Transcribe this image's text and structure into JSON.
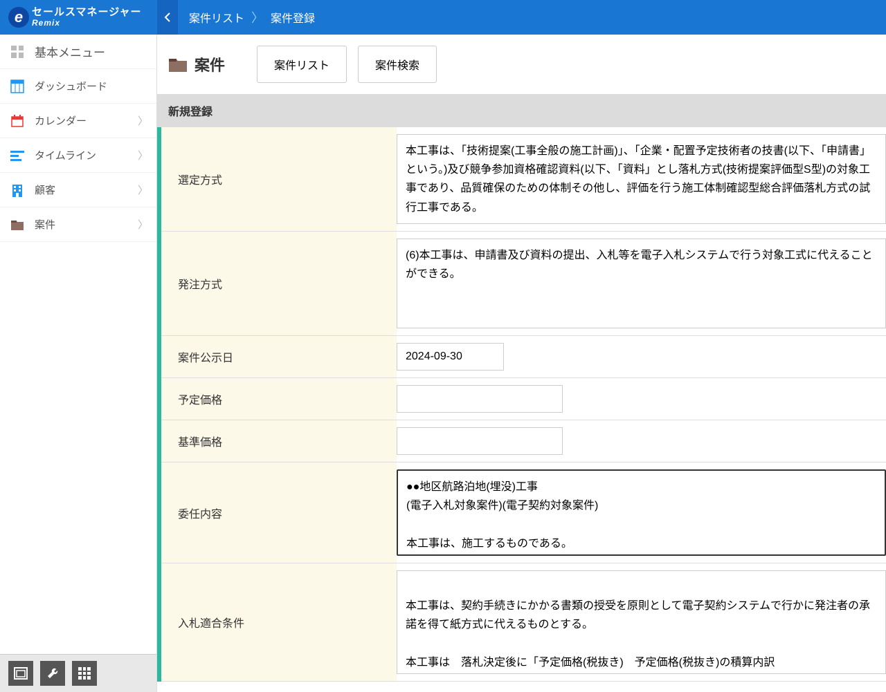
{
  "logo": {
    "main": "セールスマネージャー",
    "sub": "Remix"
  },
  "breadcrumb": {
    "item1": "案件リスト",
    "item2": "案件登録"
  },
  "sidebar": {
    "basic_menu": "基本メニュー",
    "dashboard": "ダッシュボード",
    "calendar": "カレンダー",
    "timeline": "タイムライン",
    "customer": "顧客",
    "case": "案件"
  },
  "content": {
    "title": "案件",
    "tab_list": "案件リスト",
    "tab_search": "案件検索",
    "section_new": "新規登録"
  },
  "form": {
    "selection_method": {
      "label": "選定方式",
      "value": "本工事は、「技術提案(工事全般の施工計画)」、「企業・配置予定技術者の技書(以下、「申請書」という。)及び競争参加資格確認資料(以下、「資料」とし落札方式(技術提案評価型S型)の対象工事であり、品質確保のための体制その他し、評価を行う施工体制確認型総合評価落札方式の試行工事である。"
    },
    "order_method": {
      "label": "発注方式",
      "value": "(6)本工事は、申請書及び資料の提出、入札等を電子入札システムで行う対象工式に代えることができる。"
    },
    "public_date": {
      "label": "案件公示日",
      "value": "2024-09-30"
    },
    "estimated_price": {
      "label": "予定価格",
      "value": ""
    },
    "base_price": {
      "label": "基準価格",
      "value": ""
    },
    "commission_content": {
      "label": "委任内容",
      "value": "●●地区航路泊地(埋没)工事\n(電子入札対象案件)(電子契約対象案件)\n\n本工事は、施工するものである。"
    },
    "bid_conditions": {
      "label": "入札適合条件",
      "value": "\n本工事は、契約手続きにかかる書類の授受を原則として電子契約システムで行かに発注者の承諾を得て紙方式に代えるものとする。\n\n本工事は　落札決定後に「予定価格(税抜き)　予定価格(税抜き)の積算内訳"
    }
  }
}
